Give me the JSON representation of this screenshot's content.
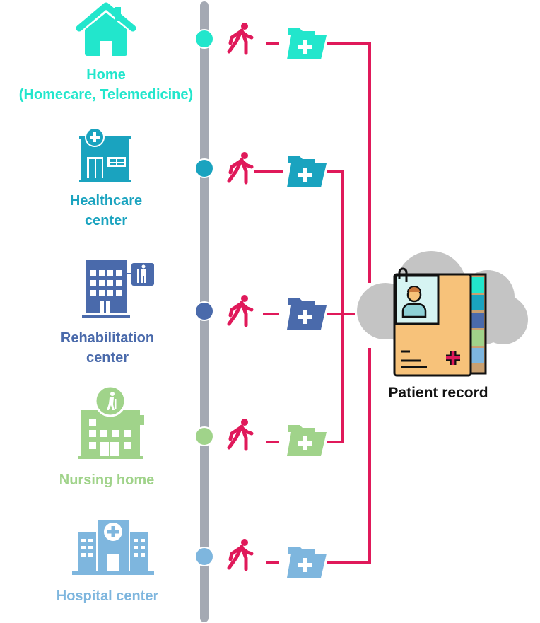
{
  "colors": {
    "home": "#22e6cc",
    "healthcare": "#1aa3bf",
    "rehabilitation": "#4a6aab",
    "nursing": "#a0d38a",
    "hospital": "#7eb6de",
    "connector": "#e0195a",
    "timeline": "#a4a9b3",
    "cloud": "#c4c4c4",
    "record": "#f7c27a"
  },
  "places": [
    {
      "line1": "Home",
      "line2": "(Homecare, Telemedicine)",
      "icon": "house-icon"
    },
    {
      "line1": "Healthcare",
      "line2": "center",
      "icon": "clinic-icon"
    },
    {
      "line1": "Rehabilitation",
      "line2": "center",
      "icon": "rehab-building-icon"
    },
    {
      "line1": "Nursing home",
      "line2": "",
      "icon": "nursing-home-icon"
    },
    {
      "line1": "Hospital center",
      "line2": "",
      "icon": "hospital-icon"
    }
  ],
  "record": {
    "label": "Patient record",
    "icon": "patient-record-folder-icon",
    "background": "cloud-icon"
  }
}
